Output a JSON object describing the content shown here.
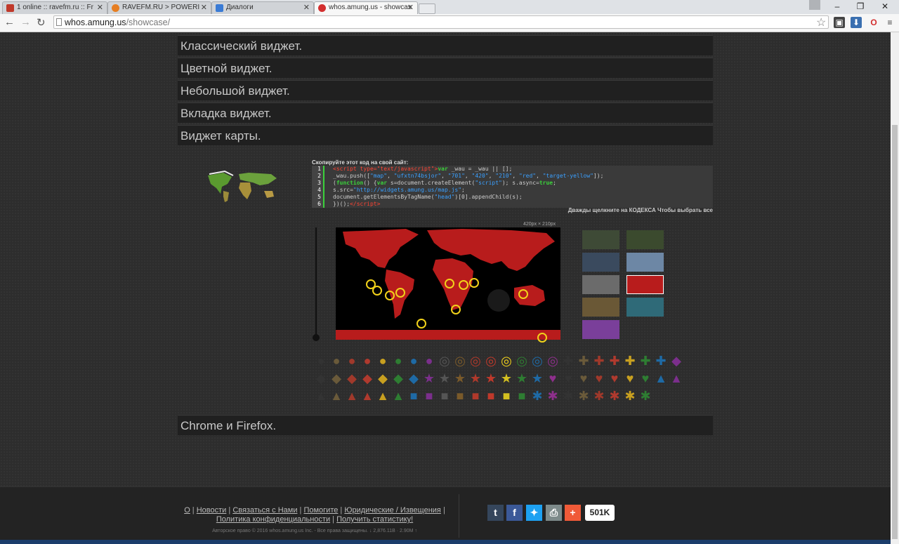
{
  "browser": {
    "tabs": [
      {
        "label": "1 online :: ravefm.ru :: Fr",
        "fav_color": "#c0392b"
      },
      {
        "label": "RAVEFM.RU > POWERI",
        "fav_color": "#e67e22"
      },
      {
        "label": "Диалоги",
        "fav_color": "#3a7bd5"
      },
      {
        "label": "whos.amung.us - showcas",
        "fav_color": "#d32f2f"
      }
    ],
    "url_host": "whos.amung.us",
    "url_path": "/showcase/"
  },
  "sections": {
    "classic": "Классический виджет.",
    "color": "Цветной виджет.",
    "small": "Небольшой виджет.",
    "tab": "Вкладка виджет.",
    "map": "Виджет карты.",
    "chrome": "Chrome и Firefox."
  },
  "code": {
    "label": "Скопируйте этот код на свой сайт:",
    "hint": "Дважды щелкните на КОДЕКСА Чтобы выбрать все",
    "numbers": [
      "1",
      "2",
      "3",
      "4",
      "5",
      "6"
    ]
  },
  "map": {
    "size_label": "420px × 210px"
  },
  "colors": {
    "map_red": "#b81c1c",
    "marker_yellow": "#f2d21a"
  },
  "footer": {
    "links": [
      "О",
      "Новости",
      "Связаться с Нами",
      "Помогите",
      "Юридические / Извещения",
      "Политика конфиденциальности",
      "Получить статистику!"
    ],
    "copyright": "Авторское право © 2016 whos.amung.us Inc. - Все права защищены.   ↓ 2,876.11B · 2.90M ↑",
    "share_count": "501K"
  }
}
